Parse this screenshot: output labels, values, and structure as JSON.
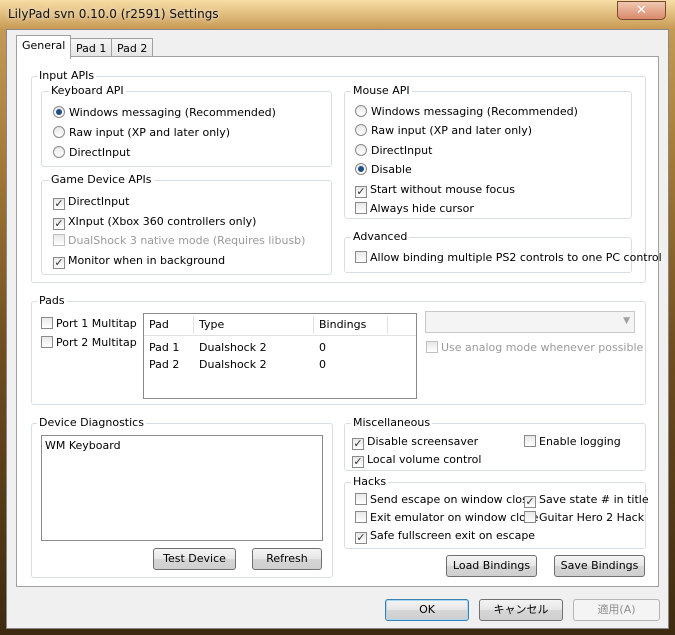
{
  "window": {
    "title": "LilyPad svn 0.10.0 (r2591) Settings",
    "close_glyph": "✕"
  },
  "tabs": [
    {
      "label": "General",
      "active": true
    },
    {
      "label": "Pad 1",
      "active": false
    },
    {
      "label": "Pad 2",
      "active": false
    }
  ],
  "input_apis": {
    "title": "Input APIs",
    "keyboard": {
      "title": "Keyboard API",
      "options": [
        {
          "label": "Windows messaging (Recommended)",
          "checked": true
        },
        {
          "label": "Raw input (XP and later only)",
          "checked": false
        },
        {
          "label": "DirectInput",
          "checked": false
        }
      ]
    },
    "game_device": {
      "title": "Game Device APIs",
      "options": [
        {
          "label": "DirectInput",
          "checked": true,
          "enabled": true
        },
        {
          "label": "XInput (Xbox 360 controllers only)",
          "checked": true,
          "enabled": true
        },
        {
          "label": "DualShock 3 native mode (Requires libusb)",
          "checked": false,
          "enabled": false
        },
        {
          "label": "Monitor when in background",
          "checked": true,
          "enabled": true
        }
      ]
    },
    "mouse": {
      "title": "Mouse API",
      "options": [
        {
          "label": "Windows messaging (Recommended)",
          "checked": false
        },
        {
          "label": "Raw input (XP and later only)",
          "checked": false
        },
        {
          "label": "DirectInput",
          "checked": false
        },
        {
          "label": "Disable",
          "checked": true
        }
      ],
      "checks": [
        {
          "label": "Start without mouse focus",
          "checked": true
        },
        {
          "label": "Always hide cursor",
          "checked": false
        }
      ]
    },
    "advanced": {
      "title": "Advanced",
      "checks": [
        {
          "label": "Allow binding multiple PS2 controls to one PC control",
          "checked": false
        }
      ]
    }
  },
  "pads": {
    "title": "Pads",
    "multitap": [
      {
        "label": "Port 1 Multitap",
        "checked": false
      },
      {
        "label": "Port 2 Multitap",
        "checked": false
      }
    ],
    "columns": [
      "Pad",
      "Type",
      "Bindings"
    ],
    "rows": [
      [
        "Pad 1",
        "Dualshock 2",
        "0"
      ],
      [
        "Pad 2",
        "Dualshock 2",
        "0"
      ]
    ],
    "combo_value": "",
    "analog": {
      "label": "Use analog mode whenever possible",
      "checked": false,
      "enabled": false
    }
  },
  "diagnostics": {
    "title": "Device Diagnostics",
    "devices": [
      "WM Keyboard"
    ],
    "test_label": "Test Device",
    "refresh_label": "Refresh"
  },
  "misc": {
    "title": "Miscellaneous",
    "checks": [
      {
        "label": "Disable screensaver",
        "checked": true
      },
      {
        "label": "Enable logging",
        "checked": false
      },
      {
        "label": "Local volume control",
        "checked": true
      }
    ]
  },
  "hacks": {
    "title": "Hacks",
    "checks": [
      {
        "label": "Send escape on window close",
        "checked": false
      },
      {
        "label": "Save state # in title",
        "checked": true
      },
      {
        "label": "Exit emulator on window close",
        "checked": false
      },
      {
        "label": "Guitar Hero 2 Hack",
        "checked": false
      },
      {
        "label": "Safe fullscreen exit on escape",
        "checked": true
      }
    ]
  },
  "bindings": {
    "load_label": "Load Bindings",
    "save_label": "Save Bindings"
  },
  "dialog": {
    "ok_label": "OK",
    "cancel_label": "キャンセル",
    "apply_label": "適用(A)"
  },
  "glyphs": {
    "checkmark": "✓",
    "dropdown": "▼"
  }
}
